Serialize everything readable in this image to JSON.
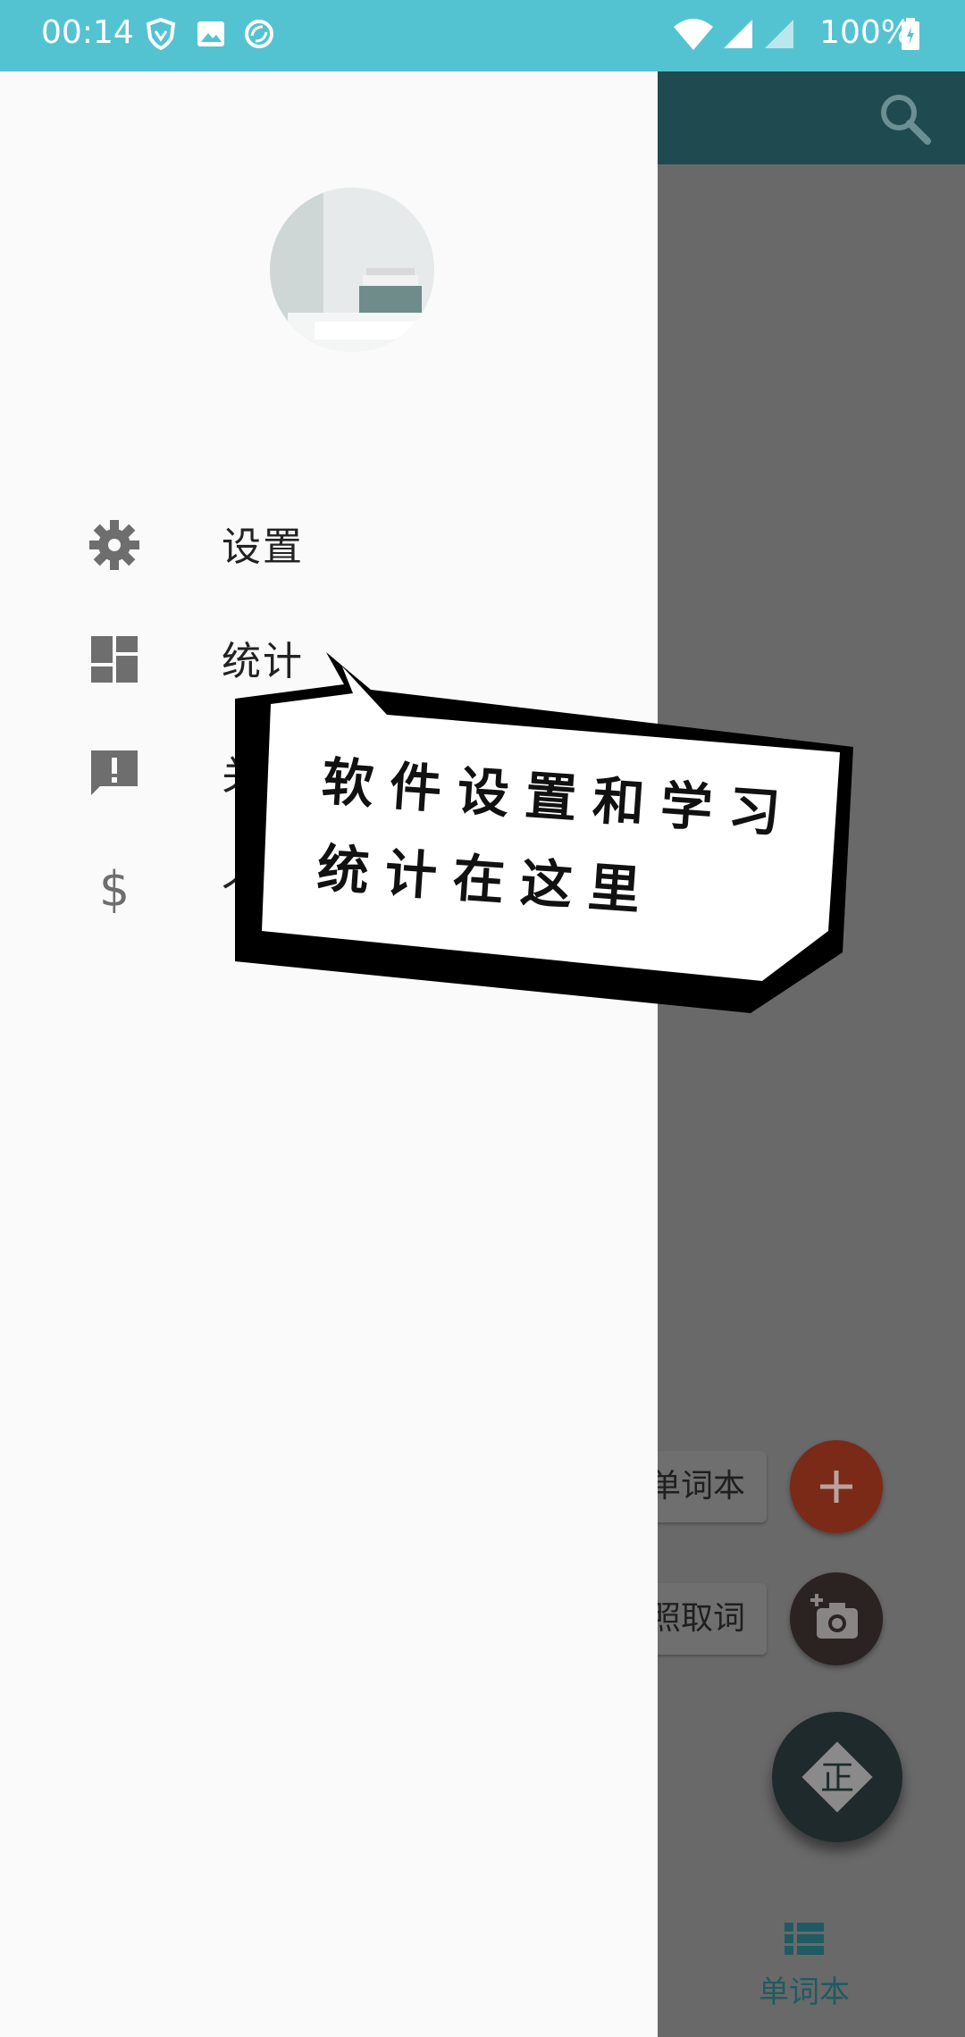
{
  "status_bar": {
    "time": "00:14",
    "battery": "100%"
  },
  "drawer": {
    "menu": [
      {
        "icon": "gear-icon",
        "label": "设置"
      },
      {
        "icon": "dashboard-icon",
        "label": "统计"
      },
      {
        "icon": "feedback-icon",
        "label": "关"
      },
      {
        "icon": "dollar-icon",
        "label": "个"
      }
    ]
  },
  "tooltip": {
    "line1": "软件设置和学习",
    "line2": "统计在这里"
  },
  "fab_menu": {
    "add_label": "单词本",
    "photo_label": "照取词",
    "main_fab_glyph": "正"
  },
  "bottom_nav": {
    "tab_label": "单词本"
  },
  "colors": {
    "status_bar": "#54c3d1",
    "toolbar": "#1f4b50",
    "add_fab": "#7a2a17",
    "photo_fab": "#2b2222",
    "accent": "#1f5b62"
  }
}
